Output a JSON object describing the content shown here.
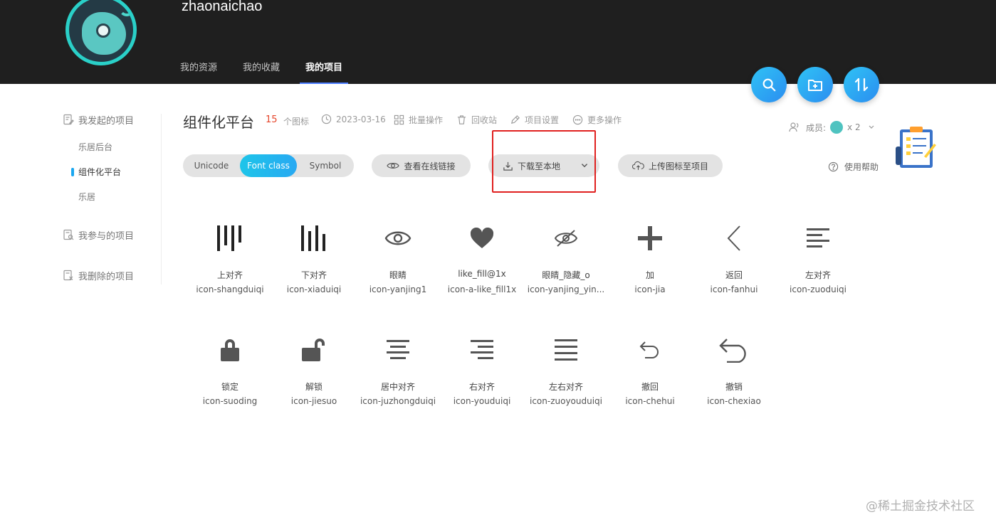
{
  "header": {
    "username": "zhaonaichao",
    "tabs": [
      {
        "label": "我的资源",
        "active": false
      },
      {
        "label": "我的收藏",
        "active": false
      },
      {
        "label": "我的项目",
        "active": true
      }
    ],
    "actions": [
      "search-icon",
      "add-folder-icon",
      "sort-icon"
    ]
  },
  "sidebar": {
    "initiated": {
      "label": "我发起的项目",
      "items": [
        {
          "label": "乐居后台",
          "active": false
        },
        {
          "label": "组件化平台",
          "active": true
        },
        {
          "label": "乐居",
          "active": false
        }
      ]
    },
    "participated": {
      "label": "我参与的项目"
    },
    "deleted": {
      "label": "我删除的项目"
    }
  },
  "project": {
    "title": "组件化平台",
    "icon_count": "15",
    "icon_count_label": "个图标",
    "date": "2023-03-16",
    "batch": "批量操作",
    "recycle": "回收站",
    "settings": "项目设置",
    "more": "更多操作",
    "members_label": "成员:",
    "members_count": "x 2",
    "help": "使用帮助"
  },
  "toolbar": {
    "modes": [
      {
        "label": "Unicode",
        "active": false
      },
      {
        "label": "Font class",
        "active": true
      },
      {
        "label": "Symbol",
        "active": false
      }
    ],
    "view_online": "查看在线链接",
    "download": "下载至本地",
    "upload": "上传图标至项目"
  },
  "icons": [
    {
      "name": "上对齐",
      "code": "icon-shangduiqi",
      "glyph": "align-top-icon"
    },
    {
      "name": "下对齐",
      "code": "icon-xiaduiqi",
      "glyph": "align-bottom-icon"
    },
    {
      "name": "眼睛",
      "code": "icon-yanjing1",
      "glyph": "eye-icon"
    },
    {
      "name": "like_fill@1x",
      "code": "icon-a-like_fill1x",
      "glyph": "heart-icon"
    },
    {
      "name": "眼睛_隐藏_o",
      "code": "icon-yanjing_yin...",
      "glyph": "eye-hidden-icon"
    },
    {
      "name": "加",
      "code": "icon-jia",
      "glyph": "plus-icon"
    },
    {
      "name": "返回",
      "code": "icon-fanhui",
      "glyph": "back-icon"
    },
    {
      "name": "左对齐",
      "code": "icon-zuoduiqi",
      "glyph": "align-left-icon"
    },
    {
      "name": "锁定",
      "code": "icon-suoding",
      "glyph": "lock-icon"
    },
    {
      "name": "解锁",
      "code": "icon-jiesuo",
      "glyph": "unlock-icon"
    },
    {
      "name": "居中对齐",
      "code": "icon-juzhongduiqi",
      "glyph": "align-center-icon"
    },
    {
      "name": "右对齐",
      "code": "icon-youduiqi",
      "glyph": "align-right-icon"
    },
    {
      "name": "左右对齐",
      "code": "icon-zuoyouduiqi",
      "glyph": "align-justify-icon"
    },
    {
      "name": "撤回",
      "code": "icon-chehui",
      "glyph": "undo-icon"
    },
    {
      "name": "撤销",
      "code": "icon-chexiao",
      "glyph": "revoke-icon"
    }
  ],
  "watermark": "@稀土掘金技术社区",
  "colors": {
    "accent": "#28a9f2",
    "count": "#e5452b",
    "highlight": "#e0201f",
    "header_bg": "#1f1f1f"
  }
}
